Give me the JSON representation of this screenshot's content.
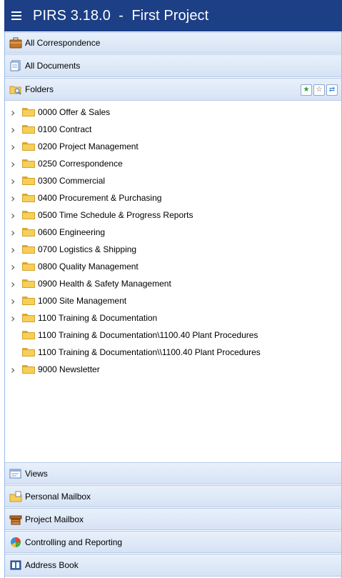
{
  "app": {
    "title": "PIRS 3.18.0  -  First Project"
  },
  "top_sections": [
    {
      "label": "All Correspondence",
      "icon": "briefcase-icon"
    },
    {
      "label": "All Documents",
      "icon": "documents-icon"
    },
    {
      "label": "Folders",
      "icon": "folder-search-icon"
    }
  ],
  "folder_tools": [
    {
      "icon": "star-add-icon",
      "glyph": "★",
      "color": "#2e9e2e"
    },
    {
      "icon": "star-icon",
      "glyph": "☆",
      "color": "#666666"
    },
    {
      "icon": "refresh-icon",
      "glyph": "⇄",
      "color": "#2a6fd6"
    }
  ],
  "folders": [
    {
      "label": "0000 Offer & Sales",
      "expandable": true
    },
    {
      "label": "0100 Contract",
      "expandable": true
    },
    {
      "label": "0200 Project Management",
      "expandable": true
    },
    {
      "label": "0250 Correspondence",
      "expandable": true
    },
    {
      "label": "0300 Commercial",
      "expandable": true
    },
    {
      "label": "0400 Procurement & Purchasing",
      "expandable": true
    },
    {
      "label": "0500 Time Schedule & Progress Reports",
      "expandable": true
    },
    {
      "label": "0600 Engineering",
      "expandable": true
    },
    {
      "label": "0700 Logistics & Shipping",
      "expandable": true
    },
    {
      "label": "0800 Quality Management",
      "expandable": true
    },
    {
      "label": "0900 Health & Safety Management",
      "expandable": true
    },
    {
      "label": "1000 Site Management",
      "expandable": true
    },
    {
      "label": "1100 Training & Documentation",
      "expandable": true
    },
    {
      "label": "1100 Training & Documentation\\1100.40 Plant Procedures",
      "expandable": false
    },
    {
      "label": "1100 Training & Documentation\\\\1100.40 Plant Procedures",
      "expandable": false
    },
    {
      "label": "9000 Newsletter",
      "expandable": true
    }
  ],
  "bottom_sections": [
    {
      "label": "Views",
      "icon": "views-icon"
    },
    {
      "label": "Personal Mailbox",
      "icon": "personal-mailbox-icon"
    },
    {
      "label": "Project Mailbox",
      "icon": "project-mailbox-icon"
    },
    {
      "label": "Controlling and Reporting",
      "icon": "pie-chart-icon"
    },
    {
      "label": "Address Book",
      "icon": "address-book-icon"
    }
  ]
}
